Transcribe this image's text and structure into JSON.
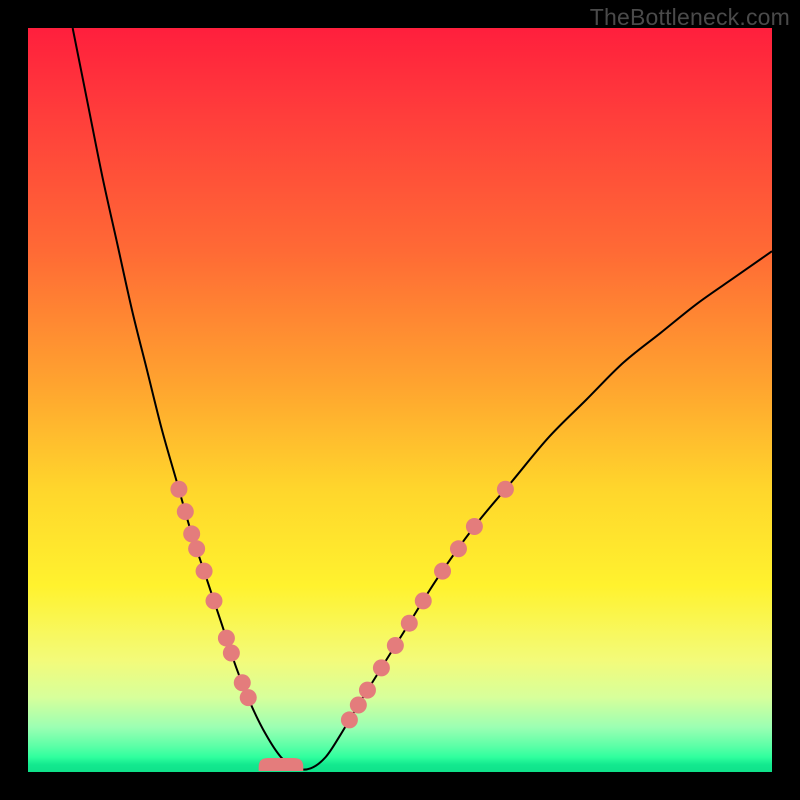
{
  "watermark": "TheBottleneck.com",
  "colors": {
    "dot": "#e47c7c",
    "curve": "#000000",
    "frame": "#000000"
  },
  "chart_data": {
    "type": "line",
    "title": "",
    "xlabel": "",
    "ylabel": "",
    "xlim": [
      0,
      100
    ],
    "ylim": [
      0,
      100
    ],
    "grid": false,
    "legend": false,
    "description": "Bottleneck-style curve: sharp V with minimum near x≈33; color background encodes badness (top red = bad, bottom green = good).",
    "series": [
      {
        "name": "bottleneck-curve",
        "x_pct": [
          6,
          8,
          10,
          12,
          14,
          16,
          18,
          20,
          22,
          24,
          26,
          28,
          30,
          32,
          34,
          36,
          38,
          40,
          42,
          45,
          50,
          55,
          60,
          65,
          70,
          75,
          80,
          85,
          90,
          95,
          100
        ],
        "y_pct": [
          100,
          90,
          80,
          71,
          62,
          54,
          46,
          39,
          32,
          26,
          20,
          14,
          9,
          5,
          2,
          0.5,
          0.5,
          2,
          5,
          10,
          18,
          26,
          33,
          39,
          45,
          50,
          55,
          59,
          63,
          66.5,
          70
        ]
      }
    ],
    "dots_left_branch_y_pct": [
      38,
      35,
      32,
      30,
      27,
      23,
      18,
      16,
      12,
      10
    ],
    "dots_right_branch_y_pct": [
      38,
      33,
      30,
      27,
      23,
      20,
      17,
      14,
      11,
      9,
      7
    ],
    "valley_center_x_pct": 34,
    "valley_width_pct": 6
  }
}
